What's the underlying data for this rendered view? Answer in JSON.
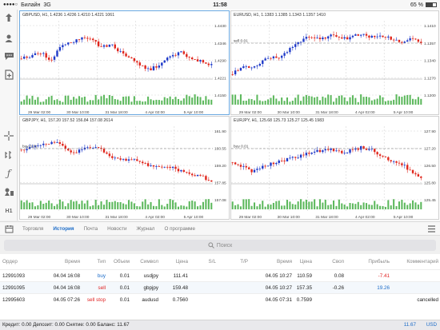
{
  "status": {
    "carrier": "Билайн",
    "network": "3G",
    "time": "11:58",
    "battery": "65 %",
    "battery_level": 0.65
  },
  "toolbar": {
    "icons": [
      "trade-icon",
      "user-icon",
      "chat-icon",
      "document-icon",
      "crosshair-icon",
      "indicators-icon",
      "function-icon",
      "objects-icon",
      "timeframe-icon"
    ],
    "timeframe_label": "H1"
  },
  "charts": [
    {
      "symbol": "GBPUSD",
      "header": "GBPUSD, H1, 1.4236 1.4236 1.4210 1.4221 1061",
      "level_label": "",
      "prices": [
        "1.4430",
        "1.4346",
        "1.4290",
        "1.4221",
        "1.4150"
      ],
      "dates": [
        "29 Mar 02:00",
        "30 Mar 10:00",
        "31 Mar 18:00",
        "4 Apr 02:00",
        "5 Apr 10:00"
      ],
      "color": "#6aa8e0"
    },
    {
      "symbol": "EURUSD",
      "header": "EURUSD, H1, 1.1383 1.1385 1.1343 1.1357 1410",
      "level_label": "sell 0.01",
      "prices": [
        "1.1410",
        "1.1357",
        "1.1340",
        "1.1270",
        "1.1200"
      ],
      "dates": [
        "29 Mar 02:00",
        "30 Mar 10:00",
        "31 Mar 18:00",
        "4 Apr 02:00",
        "5 Apr 10:00"
      ]
    },
    {
      "symbol": "GBPJPY",
      "header": "GBPJPY, H1, 157.20 157.52 156.84 157.08 2614",
      "level_label": "buy 0.01",
      "prices": [
        "161.90",
        "160.55",
        "159.20",
        "157.85",
        "157.08"
      ],
      "dates": [
        "29 Mar 02:00",
        "30 Mar 10:00",
        "31 Mar 18:00",
        "4 Apr 02:00",
        "5 Apr 10:00"
      ]
    },
    {
      "symbol": "EURJPY",
      "header": "EURJPY, H1, 125.68 125.73 125.27 125.45 1983",
      "level_label": "buy 0.01",
      "prices": [
        "127.90",
        "127.20",
        "126.50",
        "125.80",
        "125.45"
      ],
      "dates": [
        "29 Mar 02:00",
        "30 Mar 10:00",
        "31 Mar 18:00",
        "4 Apr 02:00",
        "5 Apr 10:00"
      ]
    }
  ],
  "tabs": [
    "Торговля",
    "История",
    "Почта",
    "Новости",
    "Журнал",
    "О программе"
  ],
  "active_tab": "История",
  "search": {
    "placeholder": "Поиск"
  },
  "table": {
    "headers": [
      "Ордер",
      "Время",
      "Тип",
      "Объем",
      "Символ",
      "Цена",
      "S/L",
      "T/P",
      "Время",
      "Цена",
      "Своп",
      "Прибыль",
      "Комментарий"
    ],
    "rows": [
      {
        "order": "12991093",
        "time": "04.04 16:08",
        "type": "buy",
        "volume": "0.01",
        "symbol": "usdjpy",
        "price": "111.41",
        "sl": "",
        "tp": "",
        "close_time": "04.05 10:27",
        "close_price": "110.59",
        "swap": "0.08",
        "profit": "-7.41",
        "comment": ""
      },
      {
        "order": "12991095",
        "time": "04.04 16:08",
        "type": "sell",
        "volume": "0.01",
        "symbol": "gbpjpy",
        "price": "159.48",
        "sl": "",
        "tp": "",
        "close_time": "04.05 10:27",
        "close_price": "157.35",
        "swap": "-0.26",
        "profit": "19.26",
        "comment": ""
      },
      {
        "order": "12995603",
        "time": "04.05 07:26",
        "type": "sell stop",
        "volume": "0.01",
        "symbol": "audusd",
        "price": "0.7560",
        "sl": "",
        "tp": "",
        "close_time": "04.05 07:31",
        "close_price": "0.7599",
        "swap": "",
        "profit": "",
        "comment": "cancelled"
      }
    ]
  },
  "footer": {
    "summary": "Кредит: 0.00 Депозит: 0.00 Снятие: 0.00 Баланс: 11.67",
    "balance": "11.67",
    "currency": "USD"
  },
  "colors": {
    "accent": "#1c6cc8",
    "buy": "#1c6cc8",
    "sell": "#e02020",
    "profit_pos": "#1c6cc8",
    "profit_neg": "#e02020",
    "candle_up": "#1f3ac9",
    "candle_down": "#e0261c",
    "volume": "#5cb85c"
  }
}
